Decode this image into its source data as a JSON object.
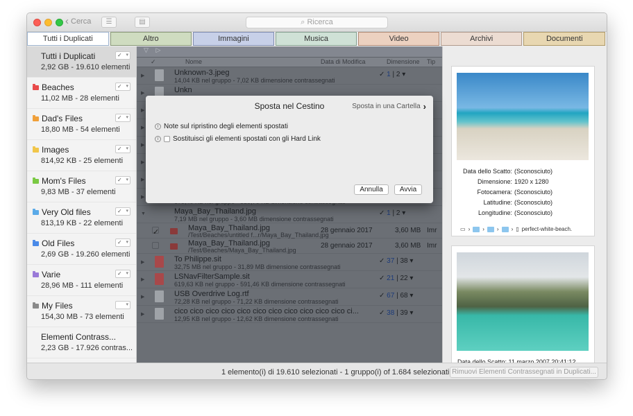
{
  "toolbar": {
    "back_label": "Cerca",
    "search_placeholder": "Ricerca"
  },
  "tabs": [
    {
      "label": "Tutti i Duplicati",
      "color": "#ffffff",
      "border": "#9fb4cf"
    },
    {
      "label": "Altro",
      "color": "#cfdcc0",
      "border": "#8a9a78"
    },
    {
      "label": "Immagini",
      "color": "#c7d0e8",
      "border": "#7f8cb1"
    },
    {
      "label": "Musica",
      "color": "#cfe1d6",
      "border": "#84a090"
    },
    {
      "label": "Video",
      "color": "#ecd1c0",
      "border": "#b08a74"
    },
    {
      "label": "Archivi",
      "color": "#ecdcd2",
      "border": "#b09a8c"
    },
    {
      "label": "Documenti",
      "color": "#e8d7b1",
      "border": "#b09a68"
    }
  ],
  "sidebar": {
    "items": [
      {
        "name": "Tutti i Duplicati",
        "meta": "2,92 GB - 19.610 elementi",
        "color": "",
        "check": "✓"
      },
      {
        "name": "Beaches",
        "meta": "11,02 MB - 28 elementi",
        "color": "#e84a4a",
        "check": "✓"
      },
      {
        "name": "Dad's Files",
        "meta": "18,80 MB - 54 elementi",
        "color": "#f0a03a",
        "check": "✓"
      },
      {
        "name": "Images",
        "meta": "814,92 KB - 25 elementi",
        "color": "#f1c64a",
        "check": "✓"
      },
      {
        "name": "Mom's Files",
        "meta": "9,83 MB - 37 elementi",
        "color": "#7ac943",
        "check": "✓"
      },
      {
        "name": "Very Old files",
        "meta": "813,19 KB - 22 elementi",
        "color": "#5aaae8",
        "check": "✓"
      },
      {
        "name": "Old Files",
        "meta": "2,69 GB - 19.260 elementi",
        "color": "#4a8ae8",
        "check": "✓"
      },
      {
        "name": "Varie",
        "meta": "28,96 MB - 111 elementi",
        "color": "#9a7ad8",
        "check": "✓"
      },
      {
        "name": "My Files",
        "meta": "154,30 MB - 73 elementi",
        "color": "#8a8a8a",
        "check": ""
      },
      {
        "name": "Elementi Contrass...",
        "meta": "2,23 GB - 17.926 contras...",
        "color": "",
        "check": ""
      }
    ]
  },
  "columns": {
    "name": "Nome",
    "date": "Data di Modifica",
    "size": "Dimensione",
    "kind": "Tip"
  },
  "rows": [
    {
      "type": "group",
      "title": "Unknown-3.jpeg",
      "sub": "14,04 KB nel gruppo - 7,02 KB dimensione contrassegnati",
      "marked": "1",
      "total": "2",
      "icon": "img"
    },
    {
      "type": "group",
      "title": "Unkn",
      "sub": "",
      "marked": "",
      "total": "",
      "icon": "img"
    },
    {
      "type": "group",
      "title": "",
      "sub": "",
      "marked": "",
      "total": "",
      "icon": "img"
    },
    {
      "type": "group",
      "title": "",
      "sub": "",
      "marked": "",
      "total": "",
      "icon": "img"
    },
    {
      "type": "group",
      "title": "",
      "sub": "",
      "marked": "",
      "total": "",
      "icon": "img"
    },
    {
      "type": "group",
      "title": "",
      "sub": "",
      "marked": "",
      "total": "",
      "icon": "img"
    },
    {
      "type": "group",
      "title": "",
      "sub": "",
      "marked": "",
      "total": "",
      "icon": "img"
    },
    {
      "type": "group",
      "title": "",
      "sub": "679,40 KB nel gruppo - 339,70 KB dimensione contrassegnati",
      "marked": "",
      "total": "",
      "icon": "img"
    },
    {
      "type": "group",
      "title": "Maya_Bay_Thailand.jpg",
      "sub": "7,19 MB nel gruppo - 3,60 MB dimensione contrassegnati",
      "marked": "1",
      "total": "2",
      "icon": "none",
      "open": true
    },
    {
      "type": "file",
      "title": "Maya_Bay_Thailand.jpg",
      "sub": "/Test/Beaches/untitled f...r/Maya_Bay_Thailand.jpg",
      "date": "28 gennaio 2017",
      "size": "3,60 MB",
      "kind": "Imr",
      "checked": true
    },
    {
      "type": "file",
      "title": "Maya_Bay_Thailand.jpg",
      "sub": "/Test/Beaches/Maya_Bay_Thailand.jpg",
      "date": "28 gennaio 2017",
      "size": "3,60 MB",
      "kind": "Imr",
      "checked": false
    },
    {
      "type": "group",
      "title": "To Philippe.sit",
      "sub": "32,75 MB nel gruppo - 31,89 MB dimensione contrassegnati",
      "marked": "37",
      "total": "38",
      "icon": "pdf"
    },
    {
      "type": "group",
      "title": "LSNavFilterSample.sit",
      "sub": "619,63 KB nel gruppo - 591,46 KB dimensione contrassegnati",
      "marked": "21",
      "total": "22",
      "icon": "pdf"
    },
    {
      "type": "group",
      "title": "USB Overdrive Log.rtf",
      "sub": "72,28 KB nel gruppo - 71,22 KB dimensione contrassegnati",
      "marked": "67",
      "total": "68",
      "icon": "doc"
    },
    {
      "type": "group",
      "title": "cico cico cico cico cico cico cico cico cico cico cico ci...",
      "sub": "12,95 KB nel gruppo - 12,62 KB dimensione contrassegnati",
      "marked": "38",
      "total": "39",
      "icon": "doc"
    }
  ],
  "preview": {
    "meta_labels": [
      "Data dello Scatto:",
      "Dimensione:",
      "Fotocamera:",
      "Latitudine:",
      "Longitudine:"
    ],
    "meta_values": [
      "(Sconosciuto)",
      "1920 x 1280",
      "(Sconosciuto)",
      "(Sconosciuto)",
      "(Sconosciuto)"
    ],
    "path_file": "perfect-white-beach.",
    "second_caption": "Data dello Scatto:  11 marzo 2007 20:41:12"
  },
  "status": {
    "text": "1 elemento(i) di 19.610 selezionati - 1 gruppo(i) of 1.684 selezionati",
    "button": "Rimuovi Elementi Contrassegnati in Duplicati..."
  },
  "sheet": {
    "title": "Sposta nel Cestino",
    "move_label": "Sposta in una Cartella",
    "option_notes": "Note sul ripristino degli elementi spostati",
    "option_hardlink": "Sostituisci gli elementi spostati con gli Hard Link",
    "cancel": "Annulla",
    "start": "Avvia"
  }
}
